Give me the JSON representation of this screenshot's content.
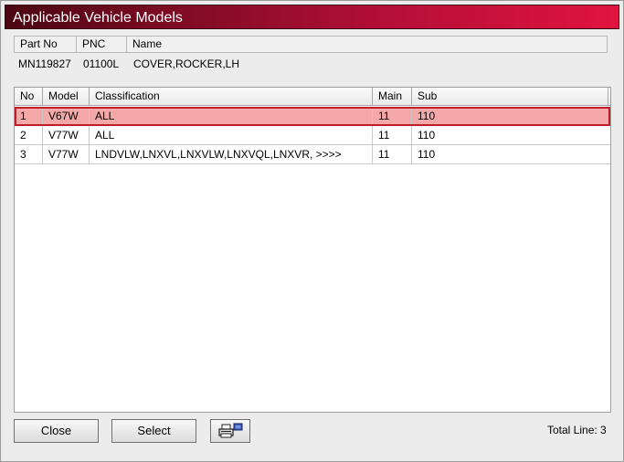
{
  "window": {
    "title": "Applicable Vehicle Models"
  },
  "part": {
    "headers": {
      "part_no": "Part No",
      "pnc": "PNC",
      "name": "Name"
    },
    "values": {
      "part_no": "MN119827",
      "pnc": "01100L",
      "name": "COVER,ROCKER,LH"
    }
  },
  "grid": {
    "headers": {
      "no": "No",
      "model": "Model",
      "classification": "Classification",
      "main": "Main",
      "sub": "Sub"
    },
    "rows": [
      {
        "no": "1",
        "model": "V67W",
        "classification": "ALL",
        "main": "11",
        "sub": "110",
        "selected": true
      },
      {
        "no": "2",
        "model": "V77W",
        "classification": "ALL",
        "main": "11",
        "sub": "110",
        "selected": false
      },
      {
        "no": "3",
        "model": "V77W",
        "classification": "LNDVLW,LNXVL,LNXVLW,LNXVQL,LNXVR,  >>>>",
        "main": "11",
        "sub": "110",
        "selected": false
      }
    ],
    "selected_color": "#f4a8a8",
    "selected_border": "#c21d2a"
  },
  "footer": {
    "close_label": "Close",
    "select_label": "Select",
    "print_icon": "printer-icon",
    "total_label": "Total Line: 3"
  }
}
